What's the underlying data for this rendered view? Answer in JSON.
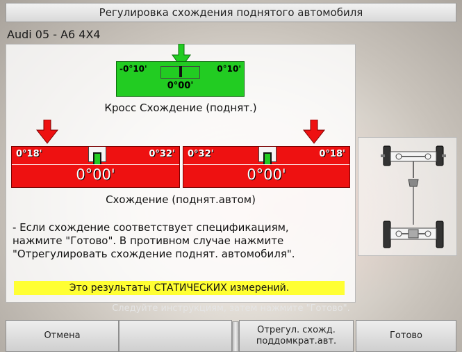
{
  "window": {
    "title": "Регулировка схождения поднятого автомобиля"
  },
  "vehicle": {
    "name": "Audi 05 - A6 4X4"
  },
  "cross_toe": {
    "min": "-0°10'",
    "max": "0°10'",
    "value": "0°00'",
    "caption": "Кросс Схождение (поднят.)",
    "color": "#22cc22"
  },
  "toe_left": {
    "min": "0°18'",
    "max": "0°32'",
    "value": "0°00'",
    "color": "#ee1111"
  },
  "toe_right": {
    "min": "0°32'",
    "max": "0°18'",
    "value": "0°00'",
    "color": "#ee1111"
  },
  "toe_caption": "Схождение (поднят.автом)",
  "instructions": {
    "line1": "- Если схождение соответствует спецификациям,",
    "line2": "нажмите \"Готово\". В противном случае нажмите",
    "line3": "\"Отрегулировать схождение поднят. автомобиля\"."
  },
  "banner": {
    "text": "Это результаты СТАТИЧЕСКИХ измерений.",
    "color": "#ffff33"
  },
  "hint": "Следуйте инструкциям, затем нажмите \"Готово\".",
  "buttons": {
    "cancel": "Отмена",
    "adjust_line1": "Отрегул. схожд.",
    "adjust_line2": "поддомкрат.авт.",
    "done": "Готово"
  },
  "icons": {
    "green_arrow": "arrow-down-icon",
    "red_arrow": "arrow-down-icon",
    "car": "car-axle-diagram-icon"
  }
}
